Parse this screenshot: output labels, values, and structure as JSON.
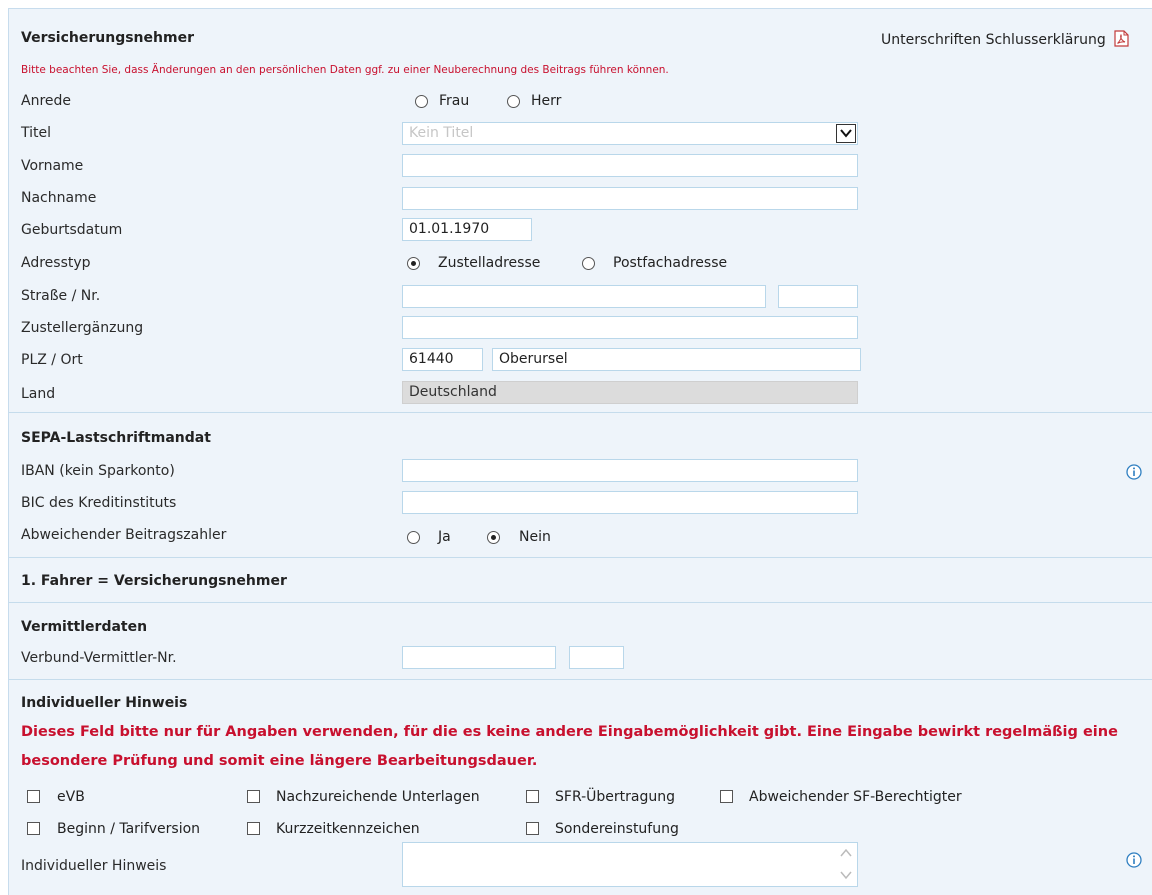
{
  "header": {
    "title": "Versicherungsnehmer",
    "signature_link": "Unterschriften Schlusserklärung",
    "notice": "Bitte beachten Sie, dass Änderungen an den persönlichen Daten ggf. zu einer Neuberechnung des Beitrags führen können."
  },
  "form": {
    "anrede": {
      "label": "Anrede",
      "options": [
        "Frau",
        "Herr"
      ],
      "selected": null
    },
    "titel": {
      "label": "Titel",
      "value": "Kein Titel"
    },
    "vorname": {
      "label": "Vorname",
      "value": ""
    },
    "nachname": {
      "label": "Nachname",
      "value": ""
    },
    "geburtsdatum": {
      "label": "Geburtsdatum",
      "value": "01.01.1970"
    },
    "adresstyp": {
      "label": "Adresstyp",
      "options": [
        "Zustelladresse",
        "Postfachadresse"
      ],
      "selected": "Zustelladresse"
    },
    "strasse": {
      "label": "Straße / Nr.",
      "street": "",
      "number": ""
    },
    "zustellergaenzung": {
      "label": "Zustellergänzung",
      "value": ""
    },
    "plz_ort": {
      "label": "PLZ / Ort",
      "plz": "61440",
      "ort": "Oberursel"
    },
    "land": {
      "label": "Land",
      "value": "Deutschland"
    }
  },
  "sepa": {
    "title": "SEPA-Lastschriftmandat",
    "iban": {
      "label": "IBAN (kein Sparkonto)",
      "value": ""
    },
    "bic": {
      "label": "BIC des Kreditinstituts",
      "value": ""
    },
    "abweichend": {
      "label": "Abweichender Beitragszahler",
      "options": [
        "Ja",
        "Nein"
      ],
      "selected": "Nein"
    }
  },
  "fahrer": {
    "title": "1. Fahrer = Versicherungsnehmer"
  },
  "vermittler": {
    "title": "Vermittlerdaten",
    "nr": {
      "label": "Verbund-Vermittler-Nr.",
      "value1": "",
      "value2": ""
    }
  },
  "hinweis": {
    "title": "Individueller Hinweis",
    "warning": "Dieses Feld bitte nur für Angaben verwenden, für die es keine andere Eingabemöglichkeit gibt. Eine Eingabe bewirkt regelmäßig eine besondere Prüfung und somit eine längere Bearbeitungsdauer.",
    "checkboxes": [
      "eVB",
      "Nachzureichende Unterlagen",
      "SFR-Übertragung",
      "Abweichender SF-Berechtigter",
      "Beginn / Tarifversion",
      "Kurzzeitkennzeichen",
      "Sondereinstufung"
    ],
    "field_label": "Individueller Hinweis",
    "field_value": ""
  },
  "colors": {
    "panel_bg": "#eef4fa",
    "border": "#b9d7ea",
    "warning": "#c8102e",
    "info": "#2f7fc1"
  },
  "icons": {
    "pdf": "pdf-icon",
    "info": "info-icon"
  }
}
